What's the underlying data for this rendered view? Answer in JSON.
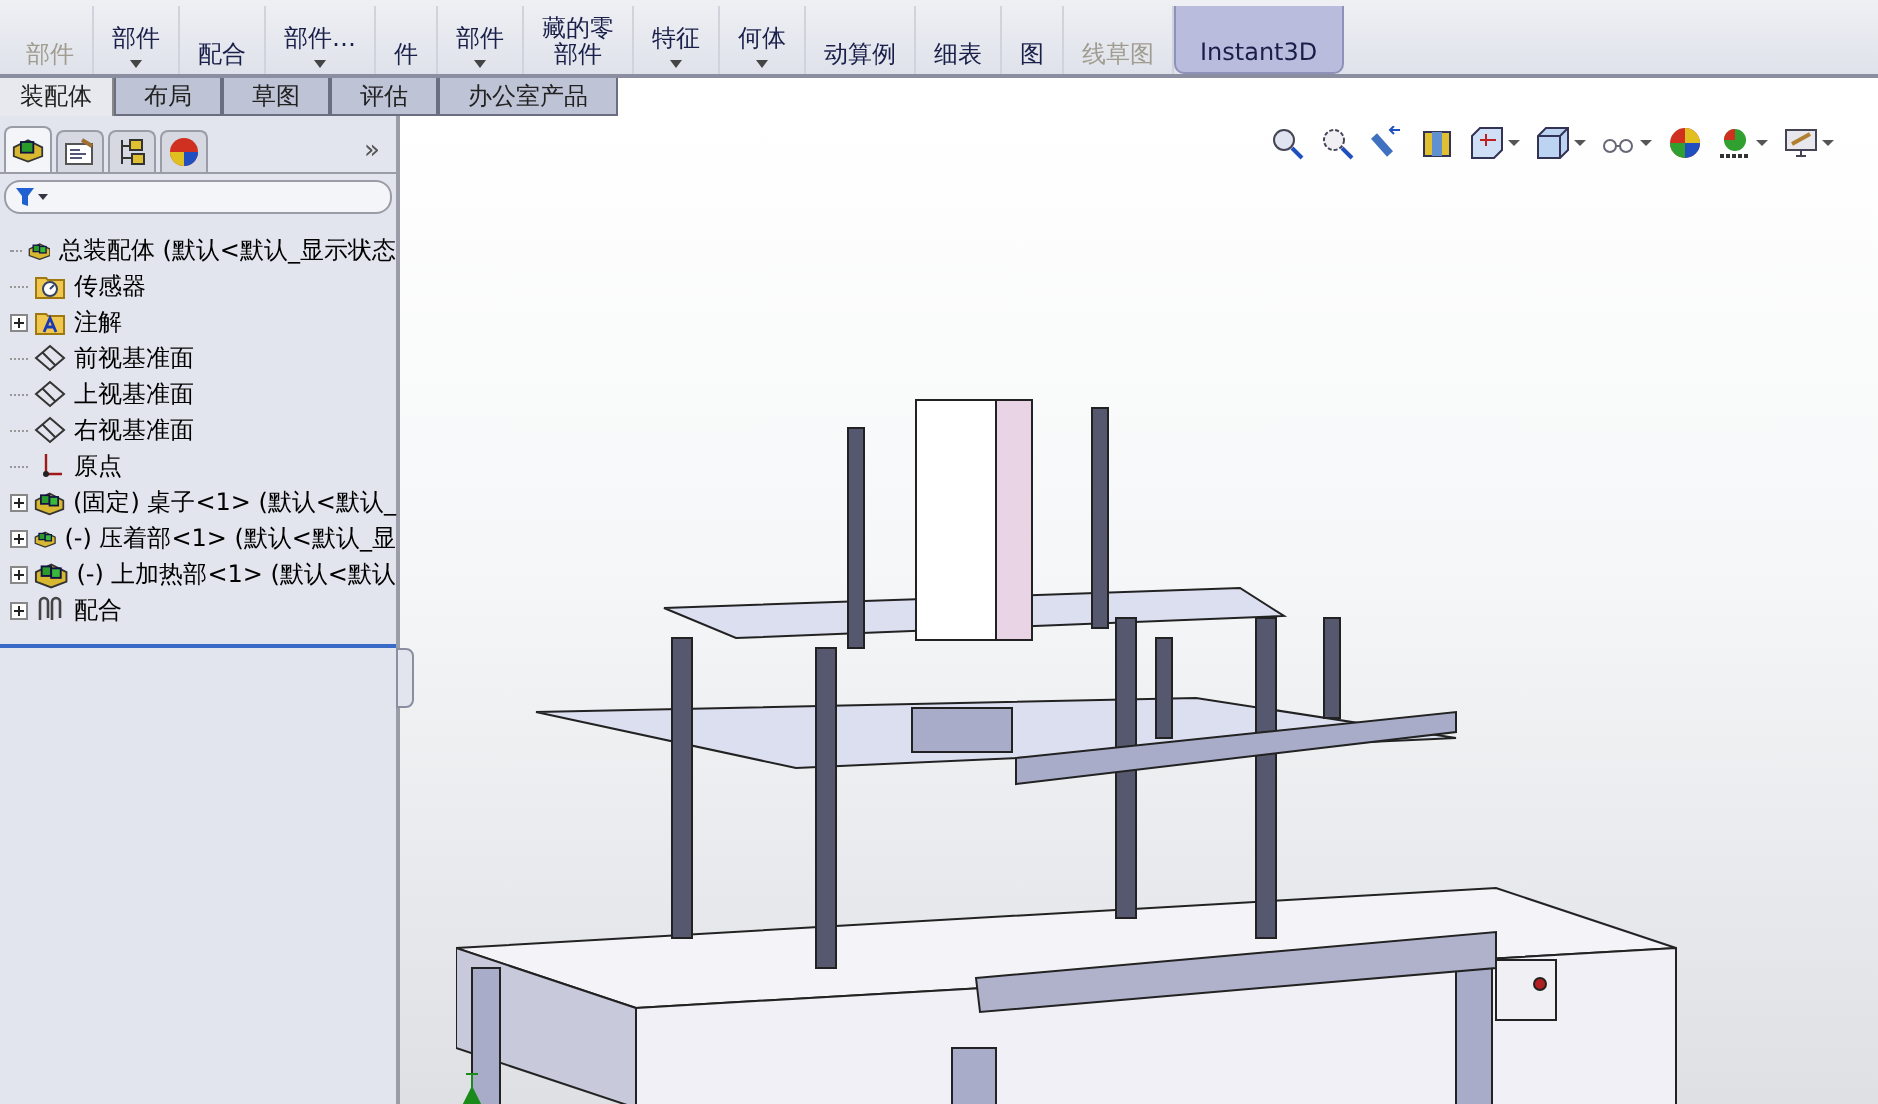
{
  "command_bar": {
    "buttons": [
      {
        "lines": [
          "部件"
        ],
        "disabled": true,
        "dropdown": false,
        "selected": false
      },
      {
        "lines": [
          "部件"
        ],
        "disabled": false,
        "dropdown": true,
        "selected": false
      },
      {
        "lines": [
          "配合"
        ],
        "disabled": false,
        "dropdown": false,
        "selected": false
      },
      {
        "lines": [
          "部件…"
        ],
        "disabled": false,
        "dropdown": true,
        "selected": false
      },
      {
        "lines": [
          "件"
        ],
        "disabled": false,
        "dropdown": false,
        "selected": false
      },
      {
        "lines": [
          "部件"
        ],
        "disabled": false,
        "dropdown": true,
        "selected": false
      },
      {
        "lines": [
          "藏的零",
          "部件"
        ],
        "disabled": false,
        "dropdown": false,
        "selected": false
      },
      {
        "lines": [
          "特征"
        ],
        "disabled": false,
        "dropdown": true,
        "selected": false
      },
      {
        "lines": [
          "何体"
        ],
        "disabled": false,
        "dropdown": true,
        "selected": false
      },
      {
        "lines": [
          "动算例"
        ],
        "disabled": false,
        "dropdown": false,
        "selected": false
      },
      {
        "lines": [
          "细表"
        ],
        "disabled": false,
        "dropdown": false,
        "selected": false
      },
      {
        "lines": [
          "图"
        ],
        "disabled": false,
        "dropdown": false,
        "selected": false
      },
      {
        "lines": [
          "线草图"
        ],
        "disabled": true,
        "dropdown": false,
        "selected": false
      },
      {
        "lines": [
          "Instant3D"
        ],
        "disabled": false,
        "dropdown": false,
        "selected": true
      }
    ]
  },
  "tabs": [
    {
      "label": "装配体",
      "selected": true
    },
    {
      "label": "布局",
      "selected": false
    },
    {
      "label": "草图",
      "selected": false
    },
    {
      "label": "评估",
      "selected": false
    },
    {
      "label": "办公室产品",
      "selected": false
    }
  ],
  "feature_tree": {
    "panel_tabs": [
      {
        "kind": "feature",
        "selected": true
      },
      {
        "kind": "property",
        "selected": false
      },
      {
        "kind": "config",
        "selected": false
      },
      {
        "kind": "display",
        "selected": false
      }
    ],
    "more": "»",
    "items": [
      {
        "kind": "assembly",
        "label": "总装配体  (默认<默认_显示状态",
        "collapsed": false,
        "children": [
          {
            "kind": "sensor",
            "label": "传感器",
            "collapsed": false
          },
          {
            "kind": "annotation",
            "label": "注解",
            "collapsed": true
          },
          {
            "kind": "plane",
            "label": "前视基准面",
            "collapsed": false
          },
          {
            "kind": "plane",
            "label": "上视基准面",
            "collapsed": false
          },
          {
            "kind": "plane",
            "label": "右视基准面",
            "collapsed": false
          },
          {
            "kind": "origin",
            "label": "原点",
            "collapsed": false
          },
          {
            "kind": "assembly",
            "label": "(固定) 桌子<1> (默认<默认_",
            "collapsed": true
          },
          {
            "kind": "assembly",
            "label": "(-) 压着部<1> (默认<默认_显",
            "collapsed": true
          },
          {
            "kind": "assembly",
            "label": "(-) 上加热部<1> (默认<默认",
            "collapsed": true
          },
          {
            "kind": "mates",
            "label": "配合",
            "collapsed": true
          }
        ]
      }
    ]
  }
}
